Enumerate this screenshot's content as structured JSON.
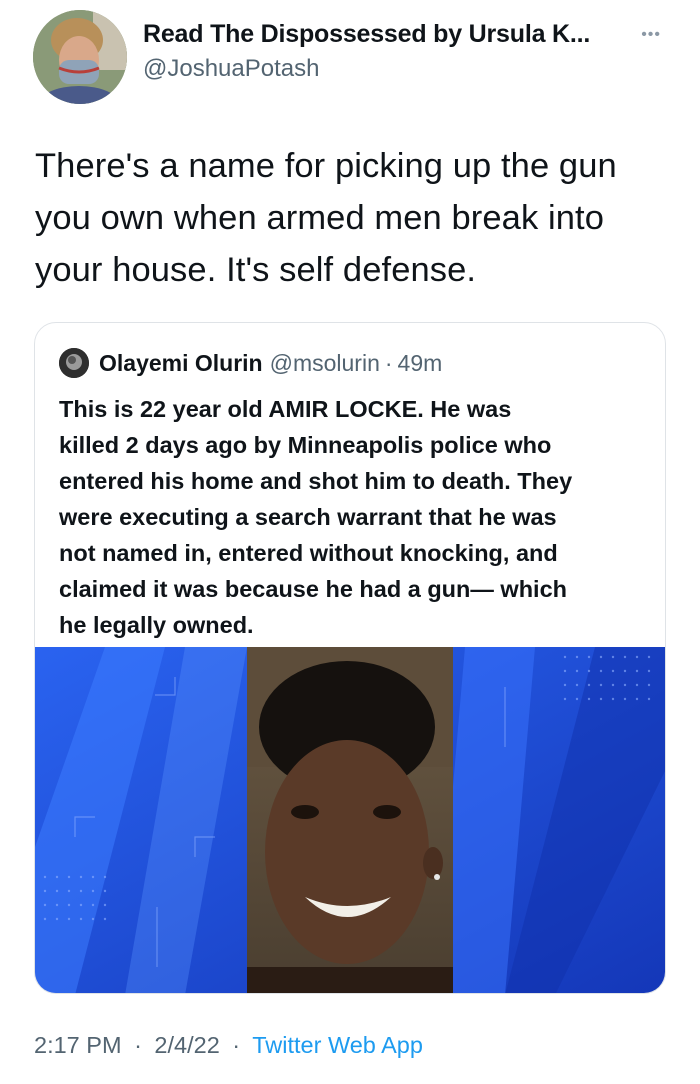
{
  "author": {
    "display_name": "Read The Dispossessed by Ursula K...",
    "handle": "@JoshuaPotash"
  },
  "more_icon": "more-horizontal-icon",
  "tweet": {
    "lines": [
      "There's a name for picking up the gun",
      "you own when armed men break into",
      "your house. It's self defense."
    ]
  },
  "quote": {
    "name": "Olayemi Olurin",
    "handle": "@msolurin",
    "separator": "·",
    "time": "49m",
    "lines": [
      "This is 22 year old AMIR LOCKE. He was",
      "killed 2 days ago by Minneapolis police who",
      "entered his home and shot him to death. They",
      "were executing a search warrant that he was",
      "not named in, entered without knocking, and",
      "claimed it was because he had a gun— which",
      "he legally owned."
    ]
  },
  "footer": {
    "time": "2:17 PM",
    "date": "2/4/22",
    "separator": "·",
    "app": "Twitter Web App"
  },
  "colors": {
    "link": "#1d9bf0",
    "secondary_text": "#536471",
    "image_blue": "#1e4fd8"
  }
}
